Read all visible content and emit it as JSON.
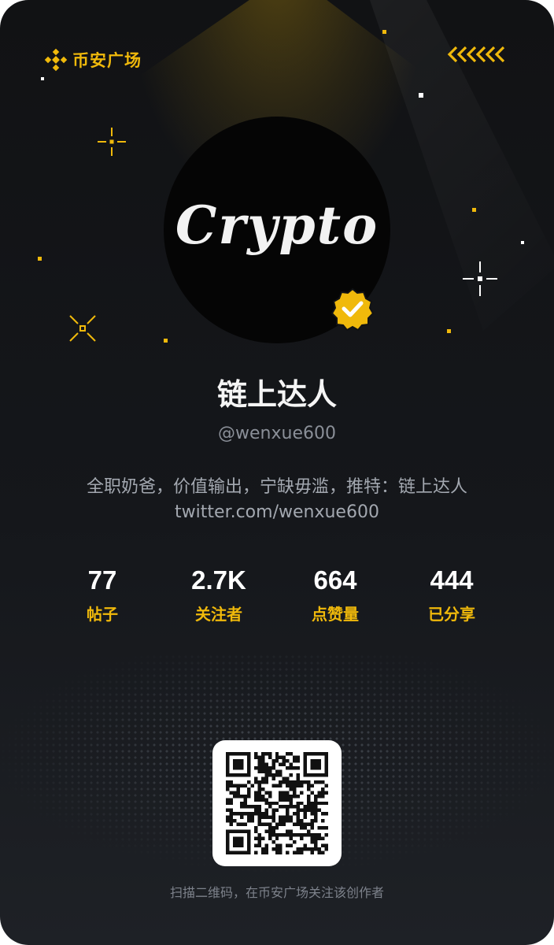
{
  "brand": {
    "name": "币安广场",
    "accent": "#F0B90B"
  },
  "icons": {
    "logo": "binance-diamond-logo-icon",
    "chevrons": "chevron-stripe-icon",
    "verified": "verified-check-badge-icon",
    "stars": "sparkle-star-icon",
    "qr": "qr-code-icon"
  },
  "profile": {
    "avatar_text": "Crypto",
    "name": "链上达人",
    "handle": "@wenxue600",
    "bio_line1": "全职奶爸，价值输出，宁缺毋滥，推特：链上达人",
    "bio_line2": "twitter.com/wenxue600"
  },
  "stats": [
    {
      "value": "77",
      "label": "帖子"
    },
    {
      "value": "2.7K",
      "label": "关注者"
    },
    {
      "value": "664",
      "label": "点赞量"
    },
    {
      "value": "444",
      "label": "已分享"
    }
  ],
  "footer": {
    "caption": "扫描二维码，在币安广场关注该创作者"
  },
  "colors": {
    "background": "#121316",
    "accent": "#F0B90B",
    "text": "#f5f5f5",
    "muted": "#8a8f98"
  }
}
